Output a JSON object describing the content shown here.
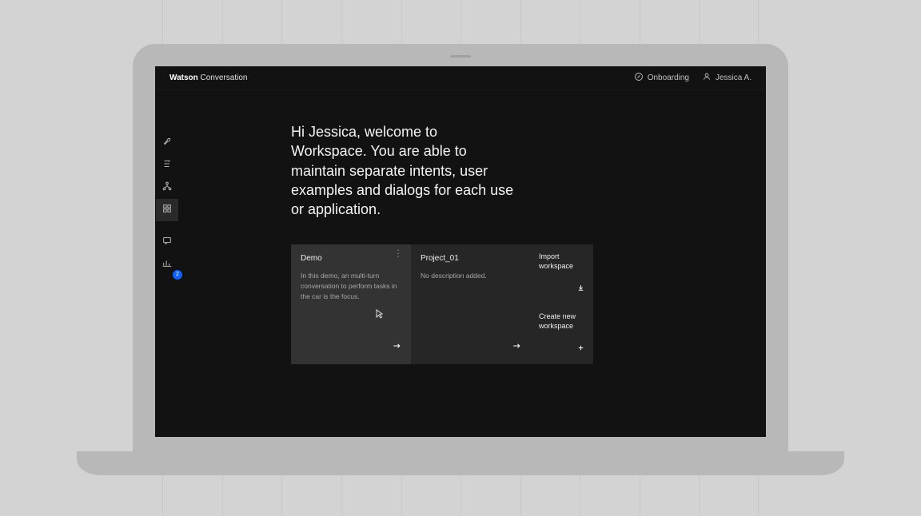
{
  "topbar": {
    "brand_bold": "Watson",
    "brand_light": " Conversation",
    "onboarding": "Onboarding",
    "user": "Jessica A."
  },
  "sidebar": {
    "badge_count": "2"
  },
  "main": {
    "welcome": "Hi Jessica, welcome to Workspace. You are able to maintain separate intents, user examples and dialogs for each use or application."
  },
  "cards": {
    "demo": {
      "title": "Demo",
      "desc": "In this demo, an multi-turn conversation to perform tasks in the car is the focus."
    },
    "project": {
      "title": "Project_01",
      "desc": "No description added."
    },
    "import": {
      "title": "Import workspace"
    },
    "create": {
      "title": "Create new workspace"
    }
  }
}
